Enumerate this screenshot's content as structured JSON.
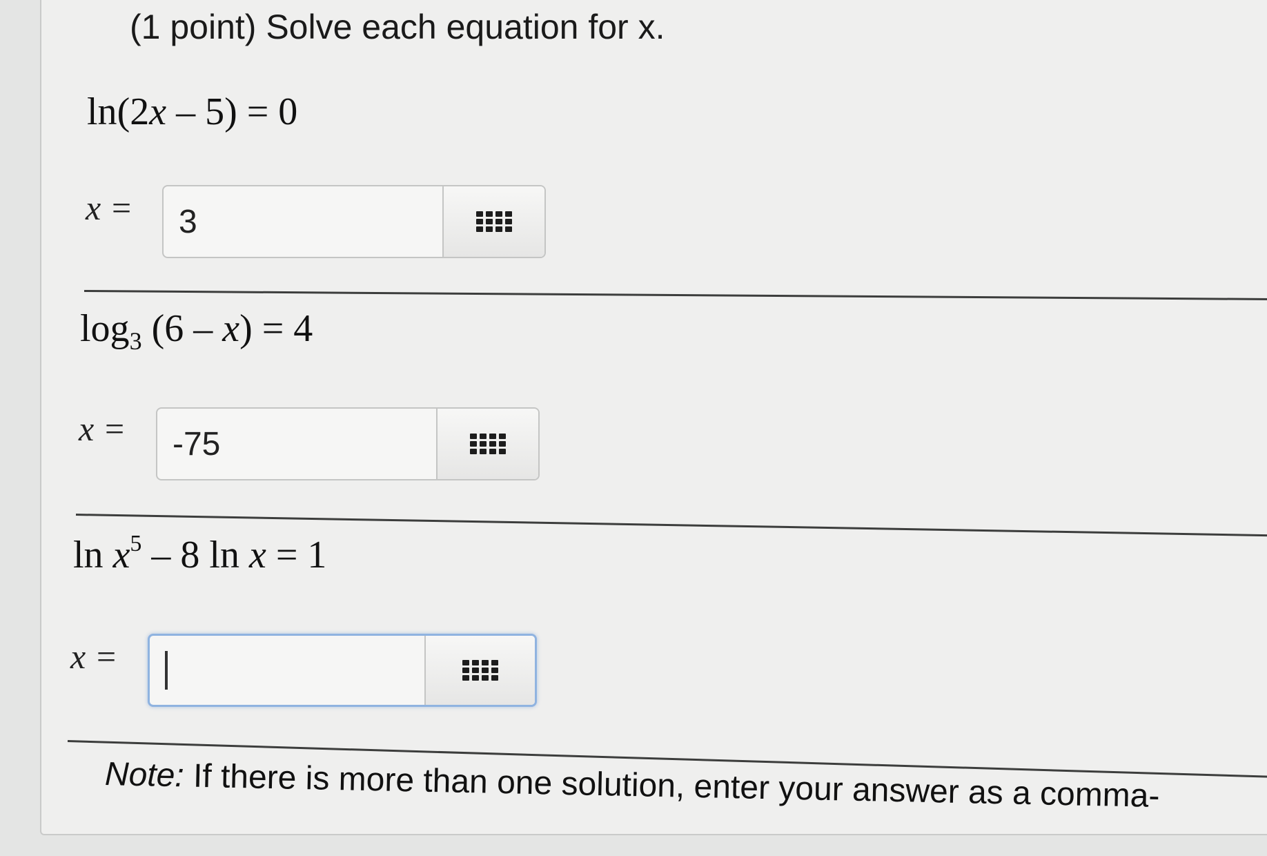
{
  "problem": {
    "header": "(1 point) Solve each equation for x.",
    "parts": [
      {
        "equation": {
          "fn": "ln",
          "arg": "(2",
          "var": "x",
          "rest": " – 5) = 0"
        },
        "answer_label": "x =",
        "answer_value": "3",
        "focused": false
      },
      {
        "equation": {
          "fn": "log",
          "base": "3",
          "arg": " (6 – ",
          "var": "x",
          "rest": ") = 4"
        },
        "answer_label": "x =",
        "answer_value": "-75",
        "focused": false
      },
      {
        "equation": {
          "fn": "ln ",
          "var": "x",
          "exp": "5",
          "rest": " – 8 ln ",
          "var2": "x",
          "rest2": " = 1"
        },
        "answer_label": "x =",
        "answer_value": "",
        "focused": true
      }
    ],
    "note_label": "Note:",
    "note_text": " If there is more than one solution, enter your answer as a comma-"
  },
  "icons": {
    "palette": "equation-palette-grid-icon"
  }
}
